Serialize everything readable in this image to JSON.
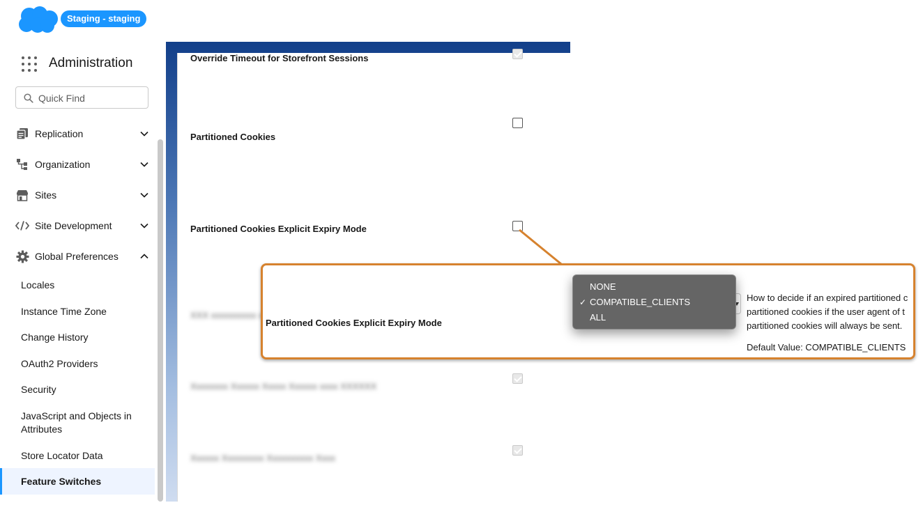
{
  "header": {
    "env_badge": "Staging - staging",
    "app_title": "Administration",
    "quick_find_placeholder": "Quick Find",
    "brand_color": "#1b96ff"
  },
  "sidebar": {
    "groups": [
      {
        "label": "Replication",
        "icon": "replication-icon",
        "expanded": false
      },
      {
        "label": "Organization",
        "icon": "organization-icon",
        "expanded": false
      },
      {
        "label": "Sites",
        "icon": "store-icon",
        "expanded": false
      },
      {
        "label": "Site Development",
        "icon": "code-icon",
        "expanded": false
      },
      {
        "label": "Global Preferences",
        "icon": "gear-icon",
        "expanded": true
      }
    ],
    "sub_items": [
      "Locales",
      "Instance Time Zone",
      "Change History",
      "OAuth2 Providers",
      "Security",
      "JavaScript and Objects in Attributes",
      "Store Locator Data",
      "Feature Switches"
    ],
    "active_item": "Feature Switches"
  },
  "main": {
    "rows": [
      {
        "label": "Override Timeout for Storefront Sessions",
        "checked": true,
        "disabled": true
      },
      {
        "label": "Partitioned Cookies",
        "checked": false,
        "disabled": false
      },
      {
        "label": "Partitioned Cookies Explicit Expiry Mode",
        "checked": false,
        "disabled": false
      }
    ]
  },
  "callout": {
    "label": "Partitioned Cookies Explicit Expiry Mode",
    "description_lines": [
      "How to decide if an expired partitioned c",
      "partitioned cookies if the user agent of t",
      "partitioned cookies will always be sent."
    ],
    "default_value": "Default Value: COMPATIBLE_CLIENTS",
    "border_color": "#d6822e"
  },
  "dropdown": {
    "options": [
      "NONE",
      "COMPATIBLE_CLIENTS",
      "ALL"
    ],
    "selected": "COMPATIBLE_CLIENTS"
  }
}
